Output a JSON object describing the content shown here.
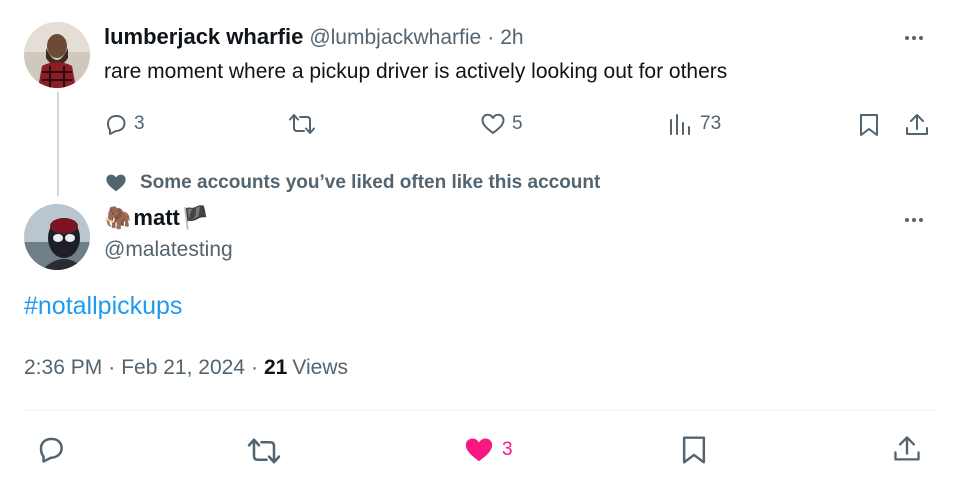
{
  "parent_tweet": {
    "display_name": "lumberjack wharfie",
    "handle": "@lumbjackwharfie",
    "separator": "·",
    "time_ago": "2h",
    "text": "rare moment where a pickup driver is actively looking out for others",
    "replies": "3",
    "likes": "5",
    "views": "73"
  },
  "social_context": {
    "text": "Some accounts you’ve liked often like this account"
  },
  "main_tweet": {
    "name_emoji": "🦣",
    "display_name": "matt",
    "name_flag": "🏴",
    "handle": "@malatesting",
    "hashtag": "#notallpickups",
    "time": "2:36 PM",
    "sep1": "·",
    "date": "Feb 21, 2024",
    "sep2": "·",
    "views_count": "21",
    "views_label": "Views",
    "likes": "3"
  },
  "colors": {
    "link": "#1d9bf0",
    "like_active": "#f91880",
    "muted": "#536471",
    "thread_line": "#cfd9de"
  },
  "icons": {
    "reply": "reply-icon",
    "retweet": "retweet-icon",
    "like": "heart-icon",
    "views": "views-bar-icon",
    "bookmark": "bookmark-icon",
    "share": "share-icon",
    "more": "more-dots-icon",
    "social": "filled-heart-icon"
  }
}
